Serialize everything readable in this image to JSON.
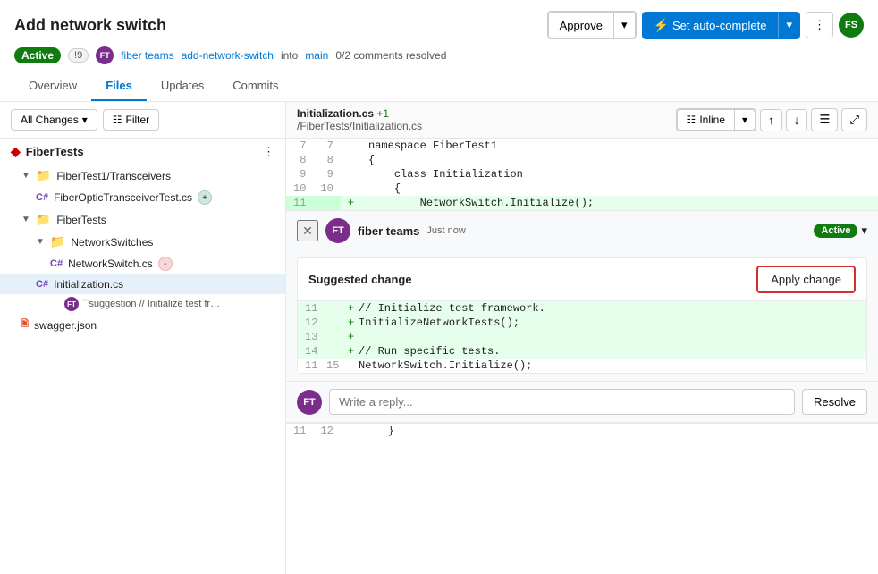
{
  "header": {
    "title": "Add network switch",
    "pr_number": "!9",
    "author_initials": "FT",
    "author_name": "fiber teams",
    "branch_from": "add-network-switch",
    "branch_into": "main",
    "comments_resolved": "0/2 comments resolved",
    "badge_active": "Active",
    "btn_approve": "Approve",
    "btn_autocomplete": "Set auto-complete",
    "avatar_initials": "FS"
  },
  "nav": {
    "tabs": [
      {
        "label": "Overview",
        "active": false
      },
      {
        "label": "Files",
        "active": true
      },
      {
        "label": "Updates",
        "active": false
      },
      {
        "label": "Commits",
        "active": false
      }
    ]
  },
  "toolbar": {
    "all_changes_label": "All Changes",
    "filter_label": "Filter",
    "file_name": "Initialization.cs",
    "file_added": "+1",
    "file_path": "/FiberTests/Initialization.cs",
    "view_label": "Inline",
    "btn_apply_label": "Apply change"
  },
  "sidebar": {
    "title": "FiberTests",
    "folders": [
      {
        "name": "FiberTest1/Transceivers",
        "indent": 1,
        "files": [
          {
            "name": "FiberOpticTransceiverTest.cs",
            "indent": 2,
            "badge": "+"
          }
        ]
      },
      {
        "name": "FiberTests",
        "indent": 1,
        "sub_folders": [
          {
            "name": "NetworkSwitches",
            "indent": 2,
            "files": [
              {
                "name": "NetworkSwitch.cs",
                "indent": 3,
                "badge": "-"
              }
            ]
          }
        ],
        "files": [
          {
            "name": "Initialization.cs",
            "indent": 2,
            "selected": true
          }
        ]
      }
    ],
    "thread_item": "``suggestion // Initialize test fram...",
    "swagger_file": "swagger.json"
  },
  "code": {
    "lines": [
      {
        "left_num": "7",
        "right_num": "7",
        "content": "namespace FiberTest1",
        "added": false
      },
      {
        "left_num": "8",
        "right_num": "8",
        "content": "{",
        "added": false
      },
      {
        "left_num": "9",
        "right_num": "9",
        "content": "    class Initialization",
        "added": false
      },
      {
        "left_num": "10",
        "right_num": "10",
        "content": "    {",
        "added": false
      },
      {
        "left_num": "11",
        "right_num": "",
        "content": "        NetworkSwitch.Initialize();",
        "added": true
      }
    ],
    "bottom_lines": [
      {
        "left_num": "11",
        "right_num": "12",
        "content": "    }"
      }
    ]
  },
  "comment": {
    "author": "fiber teams",
    "author_initials": "FT",
    "time": "Just now",
    "status": "Active",
    "suggested_change_title": "Suggested change",
    "apply_btn": "Apply change",
    "code_lines": [
      {
        "num_left": "11",
        "sign": "+",
        "code": "        // Initialize test framework.",
        "added": true
      },
      {
        "num_left": "12",
        "sign": "+",
        "code": "        InitializeNetworkTests();",
        "added": true
      },
      {
        "num_left": "13",
        "sign": "+",
        "code": "",
        "added": true
      },
      {
        "num_left": "14",
        "sign": "+",
        "code": "        // Run specific tests.",
        "added": true
      },
      {
        "num_left": "11",
        "num_right": "15",
        "sign": "",
        "code": "        NetworkSwitch.Initialize();",
        "added": false
      }
    ],
    "reply_placeholder": "Write a reply...",
    "resolve_btn": "Resolve"
  }
}
